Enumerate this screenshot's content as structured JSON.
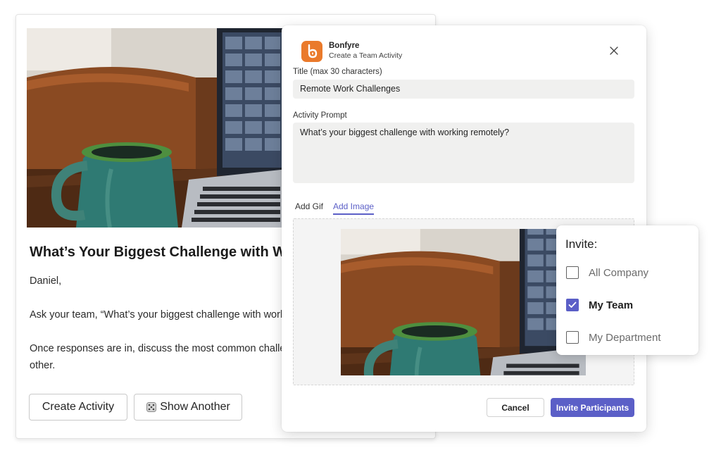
{
  "card": {
    "heading": "What’s Your Biggest Challenge with Working Remotely?",
    "greeting": "Daniel,",
    "line1": "Ask your team, “What’s your biggest challenge with working remotely?”",
    "line2": "Once responses are in, discuss the most common challenges and how you can support each",
    "line3": "other.",
    "create_button": "Create Activity",
    "show_another_button": "Show Another",
    "show_another_icon": "dice-icon"
  },
  "dialog": {
    "app_name": "Bonfyre",
    "app_subtitle": "Create a Team Activity",
    "title_label": "Title (max 30 characters)",
    "title_value": "Remote Work Challenges",
    "prompt_label": "Activity Prompt",
    "prompt_value": "What’s your biggest challenge with working remotely?",
    "tabs": [
      {
        "label": "Add Gif",
        "active": false
      },
      {
        "label": "Add Image",
        "active": true
      }
    ],
    "cancel_button": "Cancel",
    "invite_button": "Invite Participants"
  },
  "invite": {
    "title": "Invite:",
    "options": [
      {
        "label": "All Company",
        "checked": false
      },
      {
        "label": "My Team",
        "checked": true
      },
      {
        "label": "My Department",
        "checked": false
      }
    ]
  },
  "colors": {
    "accent": "#5b5fc7",
    "brand": "#ea7a2b"
  }
}
